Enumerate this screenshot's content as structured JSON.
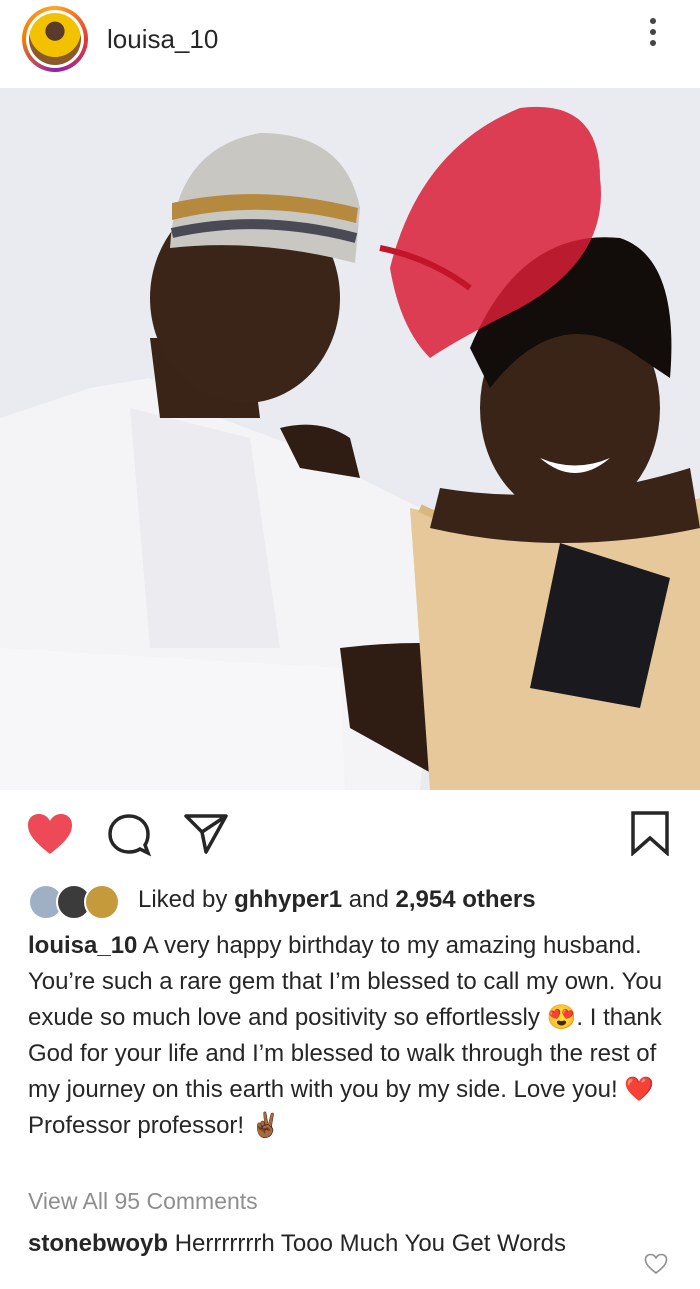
{
  "header": {
    "username": "louisa_10"
  },
  "actions": {
    "like_state": "liked",
    "like_color": "#ed4956"
  },
  "likes": {
    "prefix": "Liked by",
    "liker": "ghhyper1",
    "conjunction": "and",
    "others": "2,954 others"
  },
  "caption": {
    "user": "louisa_10",
    "part1": "A very happy birthday to my amazing husband. You’re such a rare gem that I’m blessed to call my own. You exude so much love and positivity so effortlessly",
    "emoji1": "😍",
    "part2": ". I thank God for your life and I’m blessed to walk through the rest of  my journey on this earth with you by my side. Love you! ",
    "emoji2": "❤️",
    "part3": "Professor professor! ",
    "emoji3": "✌🏾"
  },
  "comments_link": "View All 95 Comments",
  "comment": {
    "user": "stonebwoyb",
    "text": "Herrrrrrrh Tooo Much You Get Words"
  }
}
